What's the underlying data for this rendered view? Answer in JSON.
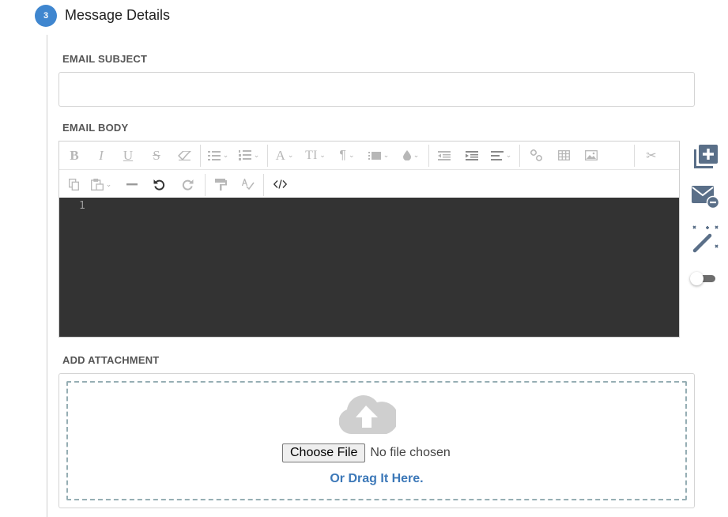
{
  "section": {
    "step_number": "3",
    "title": "Message Details",
    "accent_color": "#3f86cf"
  },
  "subject": {
    "label": "EMAIL SUBJECT",
    "value": "",
    "placeholder": ""
  },
  "body": {
    "label": "EMAIL BODY",
    "toolbar_row1": [
      {
        "name": "bold-icon",
        "glyph": "B"
      },
      {
        "name": "italic-icon",
        "glyph": "I"
      },
      {
        "name": "underline-icon",
        "glyph": "U"
      },
      {
        "name": "strikethrough-icon",
        "glyph": "S"
      },
      {
        "name": "eraser-icon",
        "glyph": "eraser"
      },
      {
        "name": "unordered-list-icon",
        "glyph": "list"
      },
      {
        "name": "ordered-list-icon",
        "glyph": "olist"
      },
      {
        "name": "font-family-icon",
        "glyph": "A"
      },
      {
        "name": "font-size-icon",
        "glyph": "TI"
      },
      {
        "name": "paragraph-icon",
        "glyph": "¶"
      },
      {
        "name": "paragraph-style-icon",
        "glyph": "block"
      },
      {
        "name": "color-icon",
        "glyph": "drop"
      },
      {
        "name": "outdent-icon",
        "glyph": "outdent"
      },
      {
        "name": "indent-icon",
        "glyph": "indent"
      },
      {
        "name": "align-icon",
        "glyph": "align"
      },
      {
        "name": "link-icon",
        "glyph": "link"
      },
      {
        "name": "table-icon",
        "glyph": "table"
      },
      {
        "name": "image-icon",
        "glyph": "image"
      },
      {
        "name": "cut-icon",
        "glyph": "✂"
      }
    ],
    "toolbar_row2": [
      {
        "name": "copy-icon",
        "glyph": "copy"
      },
      {
        "name": "paste-icon",
        "glyph": "paste"
      },
      {
        "name": "horizontal-rule-icon",
        "glyph": "—"
      },
      {
        "name": "undo-icon",
        "glyph": "undo"
      },
      {
        "name": "redo-icon",
        "glyph": "redo"
      },
      {
        "name": "format-painter-icon",
        "glyph": "paint"
      },
      {
        "name": "spellcheck-icon",
        "glyph": "spell"
      },
      {
        "name": "code-view-icon",
        "glyph": "</>"
      }
    ],
    "line_number": "1",
    "code_bg": "#333333"
  },
  "side_tools": [
    {
      "name": "add-template-icon"
    },
    {
      "name": "remove-email-icon"
    },
    {
      "name": "magic-wand-icon"
    },
    {
      "name": "toggle-switch"
    }
  ],
  "attachment": {
    "label": "ADD ATTACHMENT",
    "icon": "cloud-upload-icon",
    "choose_button": "Choose File",
    "file_status": "No file chosen",
    "drag_text": "Or Drag It Here.",
    "link_color": "#3c78b8"
  }
}
